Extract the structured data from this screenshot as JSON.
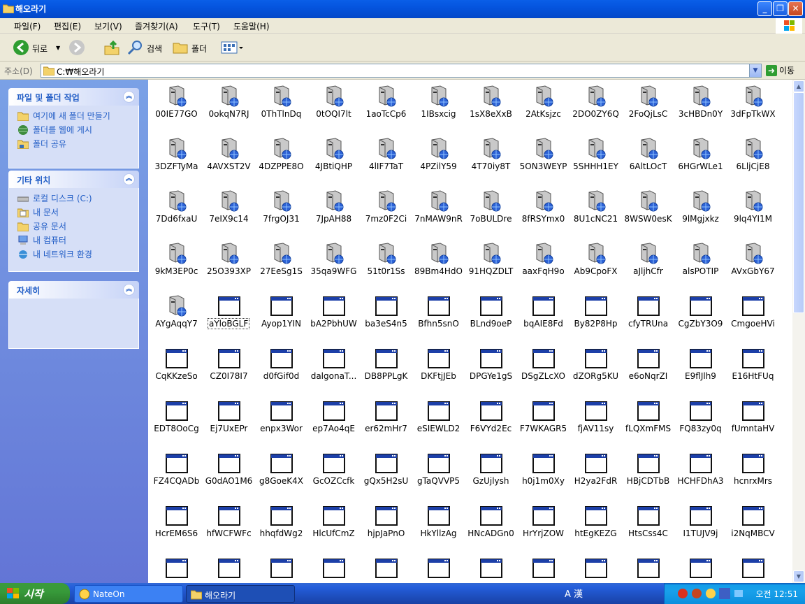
{
  "window": {
    "title": "해오라기"
  },
  "menu": [
    "파일(F)",
    "편집(E)",
    "보기(V)",
    "즐겨찾기(A)",
    "도구(T)",
    "도움말(H)"
  ],
  "toolbar": {
    "back": "뒤로",
    "search": "검색",
    "folders": "폴더"
  },
  "address": {
    "label": "주소(D)",
    "value": "C:₩해오라기",
    "go": "이동"
  },
  "sidebar": {
    "panels": [
      {
        "title": "파일 및 폴더 작업",
        "items": [
          "여기에 새 폴더 만들기",
          "폴더를 웹에 게시",
          "폴더 공유"
        ]
      },
      {
        "title": "기타 위치",
        "items": [
          "로컬 디스크 (C:)",
          "내 문서",
          "공유 문서",
          "내 컴퓨터",
          "내 네트워크 환경"
        ]
      },
      {
        "title": "자세히",
        "items": []
      }
    ]
  },
  "files": [
    "00IE77GO",
    "0okqN7RJ",
    "0ThTlnDq",
    "0tOQI7lt",
    "1aoTcCp6",
    "1IBsxcig",
    "1sX8eXxB",
    "2AtKsjzc",
    "2DO0ZY6Q",
    "2FoQjLsC",
    "3cHBDn0Y",
    "3dFpTkWX",
    "3DZFTyMa",
    "4AVXST2V",
    "4DZPPE8O",
    "4JBtiQHP",
    "4lIF7TaT",
    "4PZilY59",
    "4T70iy8T",
    "5ON3WEYP",
    "5SHHH1EY",
    "6AltLOcT",
    "6HGrWLe1",
    "6LljCjE8",
    "7Dd6fxaU",
    "7eIX9c14",
    "7frgOJ31",
    "7JpAH88",
    "7mz0F2Ci",
    "7nMAW9nR",
    "7oBULDre",
    "8fRSYmx0",
    "8U1cNC21",
    "8WSW0esK",
    "9lMgjxkz",
    "9lq4YI1M",
    "9kM3EP0c",
    "25O393XP",
    "27EeSg1S",
    "35qa9WFG",
    "51t0r1Ss",
    "89Bm4HdO",
    "91HQZDLT",
    "aaxFqH9o",
    "Ab9CpoFX",
    "aJljhCfr",
    "alsPOTIP",
    "AVxGbY67",
    "AYgAqqY7",
    "aYloBGLF",
    "Ayop1YIN",
    "bA2PbhUW",
    "ba3eS4n5",
    "Bfhn5snO",
    "BLnd9oeP",
    "bqAIE8Fd",
    "By82P8Hp",
    "cfyTRUna",
    "CgZbY3O9",
    "CmgoeHVi",
    "CqKKzeSo",
    "CZ0I78I7",
    "d0fGif0d",
    "dalgonaT...",
    "DB8PPLgK",
    "DKFtjJEb",
    "DPGYe1gS",
    "DSgZLcXO",
    "dZORg5KU",
    "e6oNqrZI",
    "E9flJlh9",
    "E16HtFUq",
    "EDT8OoCg",
    "Ej7UxEPr",
    "enpx3Wor",
    "ep7Ao4qE",
    "er62mHr7",
    "eSIEWLD2",
    "F6VYd2Ec",
    "F7WKAGR5",
    "fjAV11sy",
    "fLQXmFMS",
    "FQ83zy0q",
    "fUmntaHV",
    "FZ4CQADb",
    "G0dAO1M6",
    "g8GoeK4X",
    "GcOZCcfk",
    "gQx5H2sU",
    "gTaQVVP5",
    "GzUjlysh",
    "h0j1m0Xy",
    "H2ya2FdR",
    "HBjCDTbB",
    "HCHFDhA3",
    "hcnrxMrs",
    "HcrEM6S6",
    "hfWCFWFc",
    "hhqfdWg2",
    "HlcUfCmZ",
    "hjpJaPnO",
    "HkYllzAg",
    "HNcADGn0",
    "HrYrjZOW",
    "htEgKEZG",
    "HtsCss4C",
    "I1TUJV9j",
    "i2NqMBCV",
    "",
    "",
    "",
    "",
    "",
    "",
    "",
    "",
    "",
    "",
    "",
    ""
  ],
  "taskbar": {
    "start": "시작",
    "buttons": [
      "NateOn",
      "해오라기"
    ],
    "ime": "A 漢",
    "clock": "오전 12:51"
  }
}
